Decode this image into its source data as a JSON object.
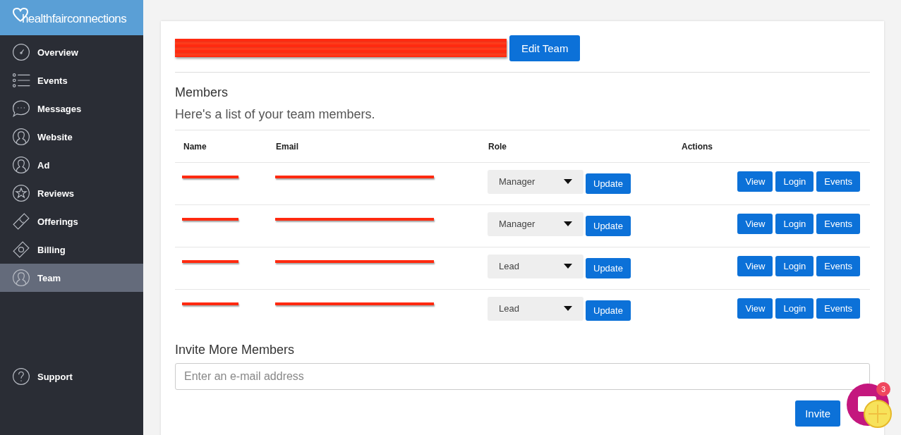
{
  "brand": {
    "logo_text": "healthfairconnections"
  },
  "sidebar": {
    "items": [
      {
        "label": "Overview",
        "selected": false
      },
      {
        "label": "Events",
        "selected": false
      },
      {
        "label": "Messages",
        "selected": false
      },
      {
        "label": "Website",
        "selected": false
      },
      {
        "label": "Ad",
        "selected": false
      },
      {
        "label": "Reviews",
        "selected": false
      },
      {
        "label": "Offerings",
        "selected": false
      },
      {
        "label": "Billing",
        "selected": false
      },
      {
        "label": "Team",
        "selected": true
      }
    ],
    "footer_items": [
      {
        "label": "Support",
        "selected": false
      }
    ]
  },
  "team": {
    "title_redacted": true,
    "edit_button": "Edit Team"
  },
  "members": {
    "heading": "Members",
    "subtitle": "Here's a list of your team members.",
    "columns": [
      "Name",
      "Email",
      "Role",
      "Actions"
    ],
    "rows": [
      {
        "name_redacted": true,
        "email_redacted": true,
        "role": "Manager",
        "update": "Update",
        "actions": [
          "View",
          "Login",
          "Events"
        ]
      },
      {
        "name_redacted": true,
        "email_redacted": true,
        "role": "Manager",
        "update": "Update",
        "actions": [
          "View",
          "Login",
          "Events"
        ]
      },
      {
        "name_redacted": true,
        "email_redacted": true,
        "role": "Lead",
        "update": "Update",
        "actions": [
          "View",
          "Login",
          "Events"
        ]
      },
      {
        "name_redacted": true,
        "email_redacted": true,
        "role": "Lead",
        "update": "Update",
        "actions": [
          "View",
          "Login",
          "Events"
        ]
      }
    ]
  },
  "invite": {
    "heading": "Invite More Members",
    "placeholder": "Enter an e-mail address",
    "button": "Invite"
  },
  "chat_widget": {
    "badge": "3"
  }
}
